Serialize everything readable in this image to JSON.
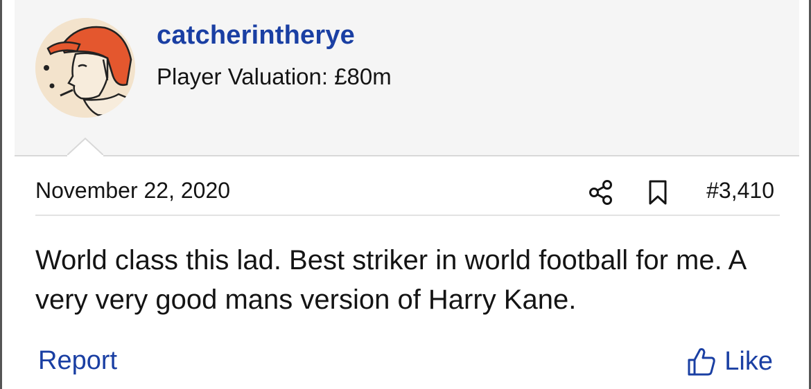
{
  "user": {
    "username": "catcherintherye",
    "valuation": "Player Valuation: £80m"
  },
  "post": {
    "date": "November 22, 2020",
    "number": "#3,410",
    "body": "World class this lad. Best striker in world football for me. A very very good mans version of Harry Kane."
  },
  "actions": {
    "report_label": "Report",
    "like_label": "Like"
  },
  "icons": {
    "share": "share-icon",
    "bookmark": "bookmark-icon",
    "like": "thumbs-up-icon"
  },
  "colors": {
    "link": "#1a3fa3",
    "text": "#141414",
    "header_bg": "#f5f5f5",
    "avatar_cap": "#e4572e"
  }
}
